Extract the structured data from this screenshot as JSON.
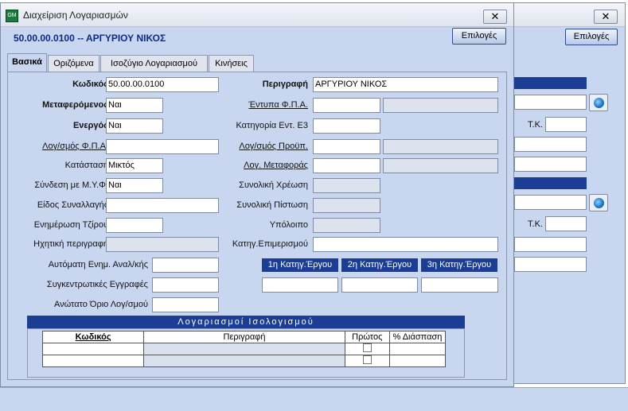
{
  "window": {
    "title": "Διαχείριση Λογαριασμών"
  },
  "header": {
    "account_title": "50.00.00.0100 -- ΑΡΓΥΡΙΟΥ ΝΙΚΟΣ",
    "options_label": "Επιλογές",
    "close_glyph": "✕"
  },
  "back_window": {
    "options_label": "Επιλογές",
    "tk_label_1": "Τ.Κ.",
    "tk_label_2": "Τ.Κ."
  },
  "tabs": [
    {
      "label": "Βασικά",
      "active": true
    },
    {
      "label": "Οριζόμενα"
    },
    {
      "label": "Ισοζύγιο Λογαριασμού"
    },
    {
      "label": "Κινήσεις"
    }
  ],
  "left": {
    "kodikos": {
      "label": "Κωδικός",
      "value": "50.00.00.0100"
    },
    "metaferomenos": {
      "label": "Μεταφερόμενος",
      "value": "Ναι"
    },
    "energos": {
      "label": "Ενεργός",
      "value": "Ναι"
    },
    "logfpa": {
      "label": "Λογ/σμός Φ.Π.Α.",
      "value": ""
    },
    "katastasi": {
      "label": "Κατάσταση",
      "value": "Μικτός"
    },
    "syndesi": {
      "label": "Σύνδεση με Μ.Υ.Φ.",
      "value": "Ναι"
    },
    "eidos": {
      "label": "Είδος Συναλλαγής",
      "value": ""
    },
    "enimerosi": {
      "label": "Ενημέρωση Τζίρου",
      "value": ""
    },
    "ixitiki": {
      "label": "Ηχητική περιγραφή",
      "value": ""
    },
    "aytomati": {
      "label": "Αυτόματη Ενημ. Αναλ/κής",
      "value": ""
    },
    "sygkentrotikes": {
      "label": "Συγκεντρωτικές Εγγραφές",
      "value": ""
    },
    "anotato": {
      "label": "Ανώτατο Όριο Λογ/σμού",
      "value": ""
    }
  },
  "right": {
    "perigrafi": {
      "label": "Περιγραφή",
      "value": "ΑΡΓΥΡΙΟΥ ΝΙΚΟΣ"
    },
    "entypa": {
      "label": "Έντυπα Φ.Π.Α.",
      "value": ""
    },
    "katigoria": {
      "label": "Κατηγορία Εντ. Ε3",
      "value": ""
    },
    "logproyp": {
      "label": "Λογ/σμός Προϋπ.",
      "value": ""
    },
    "logmetaforas": {
      "label": "Λογ. Μεταφοράς",
      "value": ""
    },
    "xreosi": {
      "label": "Συνολική Χρέωση",
      "value": ""
    },
    "pistosi": {
      "label": "Συνολική Πίστωση",
      "value": ""
    },
    "ypoloipo": {
      "label": "Υπόλοιπο",
      "value": ""
    },
    "epimerismos": {
      "label": "Κατηγ.Επιμερισμού",
      "value": ""
    },
    "erga_buttons": [
      "1η Κατηγ.Έργου",
      "2η Κατηγ.Έργου",
      "3η Κατηγ.Έργου"
    ]
  },
  "balance_table": {
    "title": "Λογαριασμοί Ισολογισμού",
    "columns": [
      "Κωδικός",
      "Περιγραφή",
      "Πρώτος",
      "% Διάσπαση"
    ],
    "rows": 2
  }
}
